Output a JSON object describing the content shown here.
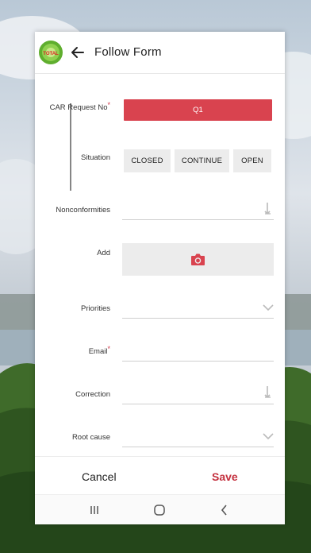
{
  "header": {
    "logo_text": "TOTAL",
    "title": "Follow Form"
  },
  "form": {
    "car_request_label": "CAR Request No",
    "car_request_required": "*",
    "car_request_value": "Q1",
    "situation_label": "Situation",
    "situation_options": [
      "CLOSED",
      "CONTINUE",
      "OPEN"
    ],
    "nonconformities_label": "Nonconformities",
    "add_label": "Add",
    "priorities_label": "Priorities",
    "email_label": "Email",
    "email_required": "*",
    "correction_label": "Correction",
    "root_cause_label": "Root cause"
  },
  "footer": {
    "cancel_label": "Cancel",
    "save_label": "Save"
  },
  "colors": {
    "accent_red": "#d9434f",
    "save_red": "#c4313f",
    "segment_bg": "#ececec"
  },
  "icons": {
    "back": "arrow-left-icon",
    "camera": "camera-icon",
    "sort": "sort-arrow-icon",
    "dropdown": "chevron-down-icon"
  }
}
